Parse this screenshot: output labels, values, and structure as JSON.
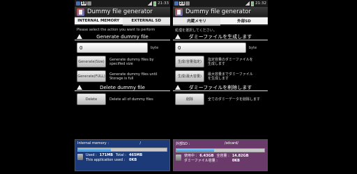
{
  "left": {
    "statusbar": {
      "badge": "19",
      "time": "21:33"
    },
    "app_title": "Dummy file generator",
    "tabs": [
      "INTERNAL MEMORY",
      "EXTERNAL SD"
    ],
    "description": "Please select the action you want to perform",
    "generate_header": "Generate dummy file",
    "size_value": "0",
    "size_unit": "byte",
    "actions": [
      {
        "button": "Generate(Size)",
        "desc_line1": "Generate dummy files by",
        "desc_line2": "specified size"
      },
      {
        "button": "Generate(FULL)",
        "desc_line1": "Generate dummy files until",
        "desc_line2": "Storage is full"
      }
    ],
    "delete_header": "Delete dummy file",
    "delete_button": "Delete",
    "delete_desc": "Delete all of dummy files",
    "storage": {
      "label": "Internal memory :",
      "path": "/",
      "fill_fraction": 0.37,
      "used_label": "Used :",
      "used_value": "171MB",
      "total_label": "Total :",
      "total_value": "465MB",
      "app_used_label": "This application used :",
      "app_used_value": "0KB"
    }
  },
  "right": {
    "statusbar": {
      "badge": "23",
      "time": "21:32"
    },
    "app_title": "Dummy file generator",
    "tabs": [
      "内蔵メモリ",
      "外部SD"
    ],
    "description": "処理を選択してください。",
    "generate_header": "ダミーファイルを生成します",
    "size_value": "0",
    "size_unit": "byte",
    "actions": [
      {
        "button": "生成(容量指定)",
        "desc_line1": "指定容量のダミーファイルを",
        "desc_line2": "生成します"
      },
      {
        "button": "生成(最大容量)",
        "desc_line1": "最大容量までダミーファイル",
        "desc_line2": "を生成します"
      }
    ],
    "delete_header": "ダミーファイルを削除します",
    "delete_button": "削除",
    "delete_desc": "全てのダミーデータを削除します",
    "storage": {
      "label": "外部SD :",
      "path": "/sdcard/",
      "fill_fraction": 0.43,
      "used_label": "使用中 :",
      "used_value": "6.43GB",
      "total_label": "全容量 :",
      "total_value": "14.82GB",
      "app_used_label": "ダミーファイル容量 :",
      "app_used_value": "0KB"
    }
  },
  "colors": {
    "internal_panel": "#1d3a78",
    "sd_panel": "#6a3a6a",
    "bar_fill": "#3f8fd0"
  }
}
